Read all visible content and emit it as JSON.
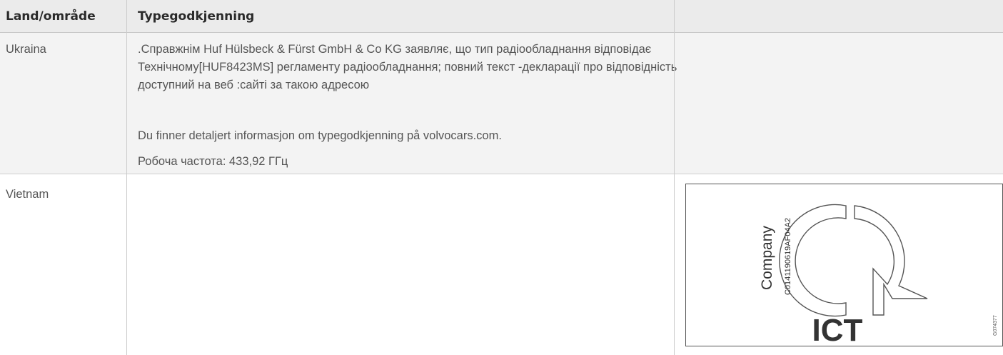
{
  "table": {
    "headers": [
      "Land/område",
      "Typegodkjenning",
      ""
    ],
    "rows": [
      {
        "country": "Ukraina",
        "approval_text": ".Справжнім Huf Hülsbeck & Fürst GmbH & Co KG заявляє, що тип радіообладнання відповідає Технічному[HUF8423MS] регламенту радіообладнання; повний текст -декларації про відповідність доступний на веб :сайті за такою адресою",
        "info_text": "Du finner detaljert informasjon om typegodkjenning på volvocars.com.",
        "frequency_text": "Робоча частота: 433,92 ГГц"
      },
      {
        "country": "Vietnam",
        "ict_label": {
          "company": "Company",
          "code": "C0141190619AF04A2",
          "mark": "ICT",
          "figure_id": "G074377"
        }
      }
    ]
  }
}
